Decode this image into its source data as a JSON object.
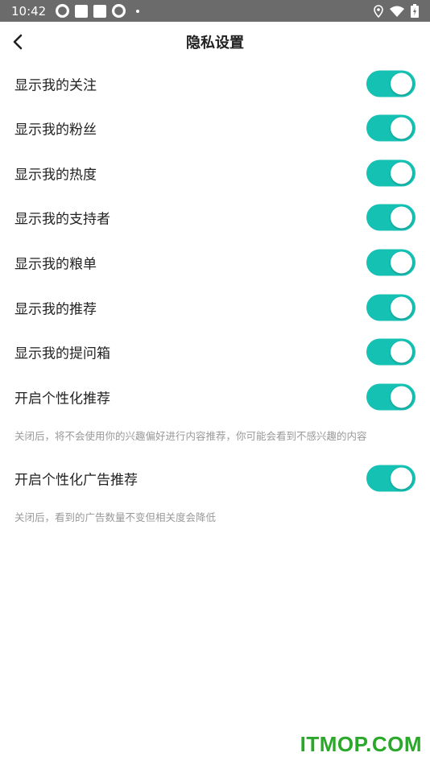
{
  "status_bar": {
    "time": "10:42"
  },
  "header": {
    "title": "隐私设置"
  },
  "settings": [
    {
      "label": "显示我的关注",
      "on": true
    },
    {
      "label": "显示我的粉丝",
      "on": true
    },
    {
      "label": "显示我的热度",
      "on": true
    },
    {
      "label": "显示我的支持者",
      "on": true
    },
    {
      "label": "显示我的粮单",
      "on": true
    },
    {
      "label": "显示我的推荐",
      "on": true
    },
    {
      "label": "显示我的提问箱",
      "on": true
    },
    {
      "label": "开启个性化推荐",
      "on": true,
      "note": "关闭后，将不会使用你的兴趣偏好进行内容推荐，你可能会看到不感兴趣的内容"
    },
    {
      "label": "开启个性化广告推荐",
      "on": true,
      "note": "关闭后，看到的广告数量不变但相关度会降低"
    }
  ],
  "watermark": "ITMOP.COM",
  "colors": {
    "toggle_on": "#14c1b3",
    "status_bar": "#6b6b6b",
    "note_text": "#999999",
    "watermark": "#2aa82a"
  }
}
